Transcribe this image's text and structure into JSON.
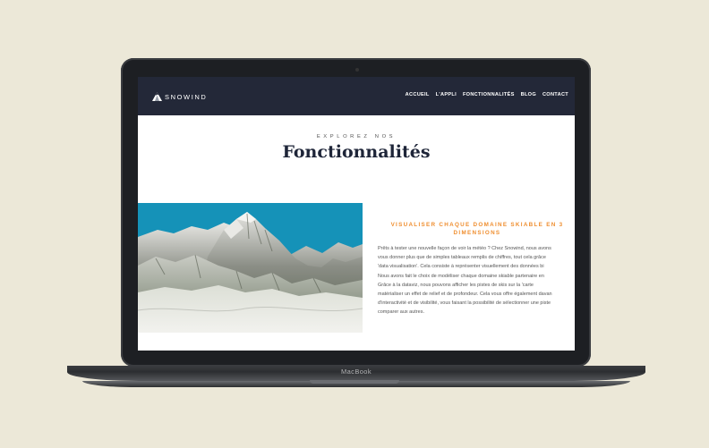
{
  "device": {
    "brand": "MacBook"
  },
  "nav": {
    "logo_text": "SNOWIND",
    "links": [
      "ACCUEIL",
      "L'APPLI",
      "FONCTIONNALITÉS",
      "BLOG",
      "CONTACT"
    ]
  },
  "hero": {
    "kicker": "EXPLOREZ NOS",
    "title": "Fonctionnalités"
  },
  "feature": {
    "heading": "VISUALISER CHAQUE DOMAINE SKIABLE EN 3\nDIMENSIONS",
    "lines": [
      "Prêts à tester une nouvelle façon de voir la météo ? Chez Snowind, nous avons",
      "vous donner plus que de simples tableaux remplis de chiffres, tout cela grâce",
      "'data visualisation'. Cela consiste à représenter visuellement des données bi",
      "Nous avons fait le choix de modéliser chaque domaine skiable partenaire en",
      "Grâce à la dataviz, nous pouvons afficher les pistes de skis sur la 'carte",
      "matérialiser un effet de relief et de profondeur. Cela vous offre également davan",
      "d'interactivité et de visibilité, vous faisant la possibilité de sélectionner une piste",
      "comparer aux autres."
    ]
  },
  "colors": {
    "background": "#ece8d8",
    "nav": "#232838",
    "accent": "#ef8e2f",
    "title": "#1e2538",
    "sky": "#1592b8"
  },
  "image": {
    "icon": "mountain-3d-render"
  }
}
